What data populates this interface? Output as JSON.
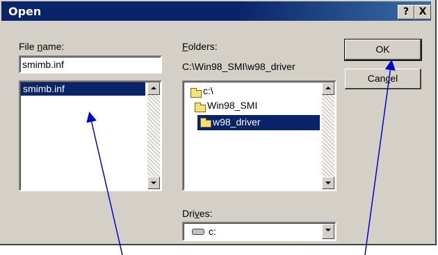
{
  "dialog": {
    "title": "Open",
    "help_button": "?",
    "close_button": "X"
  },
  "file_name": {
    "label_prefix": "File ",
    "label_accel": "n",
    "label_suffix": "ame:",
    "value": "smimb.inf",
    "list": [
      "smimb.inf"
    ],
    "selected": "smimb.inf"
  },
  "folders": {
    "label_accel": "F",
    "label_suffix": "olders:",
    "current_path": "C:\\Win98_SMI\\w98_driver",
    "tree": [
      "c:\\",
      "Win98_SMI",
      "w98_driver"
    ],
    "selected": "w98_driver"
  },
  "drives": {
    "label_prefix": "Dri",
    "label_accel": "v",
    "label_suffix": "es:",
    "value": "c:"
  },
  "buttons": {
    "ok": "OK",
    "cancel_prefix": "Can",
    "cancel_accel": "c",
    "cancel_suffix": "el"
  },
  "colors": {
    "title_bar": "#0a246a",
    "selection": "#0a246a",
    "face": "#d4d0c8",
    "annotation_arrow": "#0000cc"
  },
  "icons": [
    "help-icon",
    "close-icon",
    "folder-open-icon",
    "drive-icon",
    "scroll-up-arrow-icon",
    "scroll-down-arrow-icon",
    "dropdown-arrow-icon"
  ]
}
